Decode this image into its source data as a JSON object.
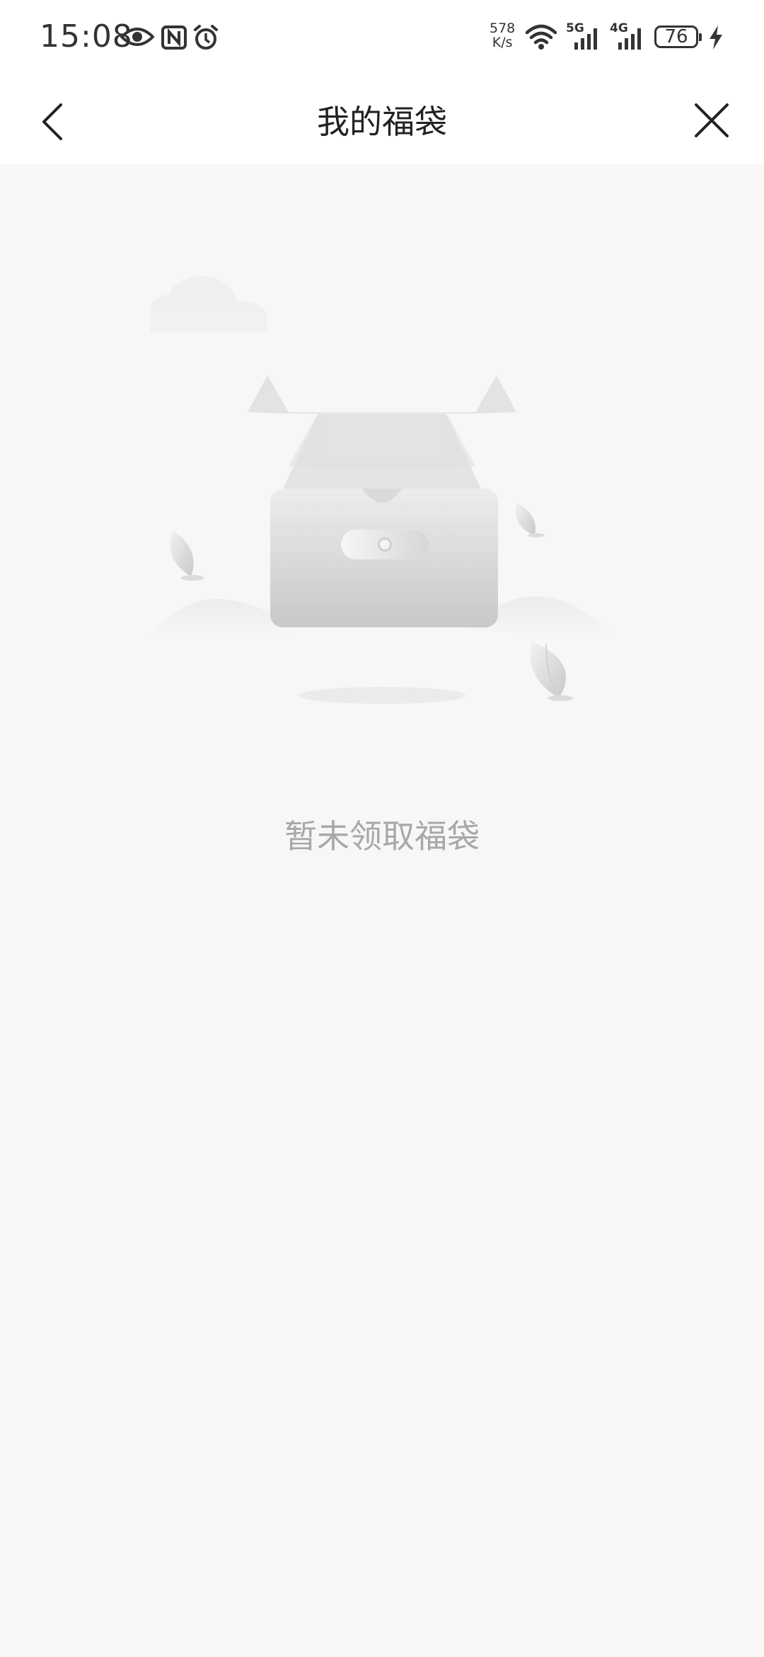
{
  "status_bar": {
    "time": "15:08",
    "net_speed_value": "578",
    "net_speed_unit": "K/s",
    "signal_1_label": "5G",
    "signal_2_label": "4G",
    "battery_level": "76",
    "icons": [
      "eye-icon",
      "nfc-icon",
      "alarm-icon",
      "wifi-icon",
      "signal-icon",
      "charging-icon"
    ]
  },
  "nav": {
    "title": "我的福袋",
    "back_icon": "chevron-left-icon",
    "close_icon": "close-icon"
  },
  "empty_state": {
    "message": "暂未领取福袋",
    "illustration": "empty-box-illustration"
  },
  "colors": {
    "background": "#f7f7f7",
    "bar": "#ffffff",
    "title": "#222222",
    "empty_text": "#a8a8a8"
  }
}
